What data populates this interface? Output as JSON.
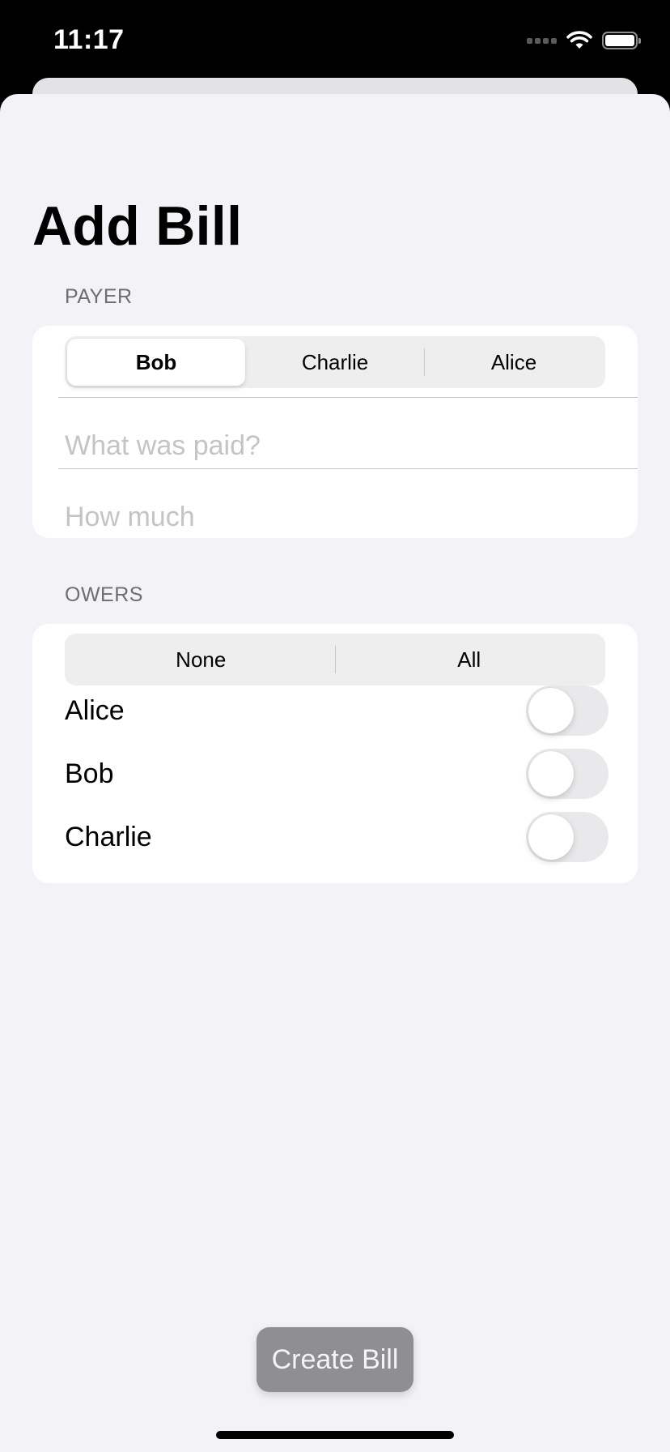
{
  "status_bar": {
    "time": "11:17",
    "icons": [
      "cellular-signal-icon",
      "wifi-icon",
      "battery-icon"
    ]
  },
  "title": "Add Bill",
  "payer_section": {
    "header": "PAYER",
    "segments": [
      {
        "label": "Bob",
        "selected": true
      },
      {
        "label": "Charlie",
        "selected": false
      },
      {
        "label": "Alice",
        "selected": false
      }
    ],
    "description_field": {
      "value": "",
      "placeholder": "What was paid?"
    },
    "amount_field": {
      "value": "",
      "placeholder": "How much"
    }
  },
  "owers_section": {
    "header": "OWERS",
    "segments": [
      {
        "label": "None"
      },
      {
        "label": "All"
      }
    ],
    "owers": [
      {
        "name": "Alice",
        "on": false
      },
      {
        "name": "Bob",
        "on": false
      },
      {
        "name": "Charlie",
        "on": false
      }
    ]
  },
  "create_button_label": "Create Bill",
  "colors": {
    "background": "#f2f2f7",
    "card": "#ffffff",
    "button_disabled": "#8e8e93",
    "placeholder": "#c4c4c6",
    "section_header": "#6d6d72"
  }
}
